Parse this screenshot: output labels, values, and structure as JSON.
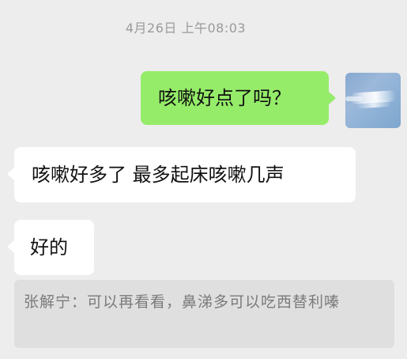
{
  "chat": {
    "timestamp": "4月26日 上午08:03",
    "messages": [
      {
        "direction": "out",
        "text": "咳嗽好点了吗？"
      },
      {
        "direction": "in",
        "text": "咳嗽好多了 最多起床咳嗽几声"
      },
      {
        "direction": "in",
        "text": "好的"
      }
    ],
    "quote": {
      "text": "张解宁：可以再看看，鼻涕多可以吃西替利嗪"
    }
  },
  "colors": {
    "background": "#ededed",
    "outgoing_bubble": "#95ec69",
    "incoming_bubble": "#ffffff",
    "quote_background": "#dfdfdf",
    "timestamp_text": "#9a9a9a"
  },
  "icons": {
    "avatar": "sky-photo-avatar"
  }
}
